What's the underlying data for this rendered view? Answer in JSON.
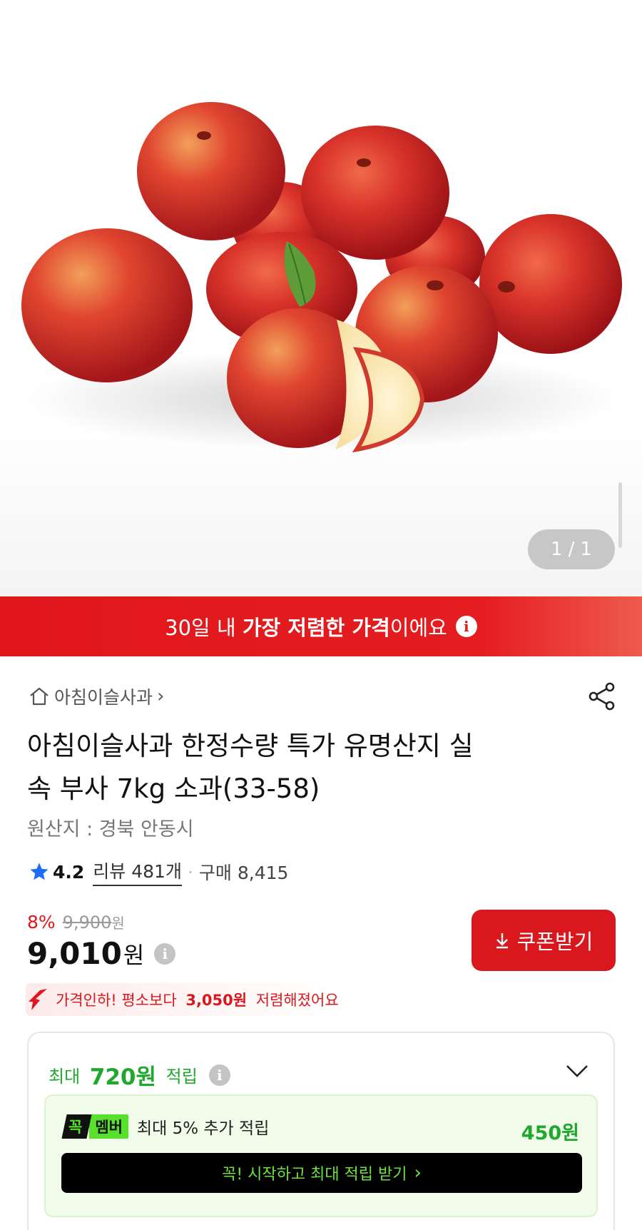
{
  "hero": {
    "image_alt": "apples product photo",
    "page_counter": {
      "current": "1",
      "separator": "/",
      "total": "1"
    }
  },
  "banner": {
    "prefix": "30일 내 ",
    "highlight": "가장 저렴한 가격",
    "suffix": "이에요",
    "info_icon": "i"
  },
  "store": {
    "home_icon": "home-icon",
    "name": "아침이슬사과",
    "chevron": "›"
  },
  "product": {
    "title_line1": "아침이슬사과 한정수량 특가 유명산지 실",
    "title_line2": "속 부사 7kg 소과(33-58)",
    "origin": "원산지 : 경북 안동시"
  },
  "rating": {
    "score": "4.2",
    "review": "리뷰 481개",
    "purchase": "구매 8,415",
    "separator": "·"
  },
  "price": {
    "discount_rate": "8%",
    "original": "9,900",
    "original_unit": "원",
    "final": "9,010",
    "final_unit": "원",
    "info_icon": "i"
  },
  "coupon": {
    "label": "쿠폰받기",
    "icon": "download-icon"
  },
  "price_drop": {
    "prefix": "가격인하! 평소보다 ",
    "amount": "3,050원",
    "suffix": " 저렴해졌어요"
  },
  "points": {
    "prefix": "최대 ",
    "amount": "720원",
    "suffix": " 적립",
    "info_icon": "i",
    "member": {
      "badge_left": "꼭",
      "badge_right": "멤버",
      "text": "최대 5% 추가 적립",
      "amount": "450원",
      "button": "꼭! 시작하고 최대 적립 받기",
      "button_chevron": "›"
    }
  },
  "colors": {
    "brand_red": "#e0161b",
    "points_green": "#20a82e",
    "member_green": "#57e02c"
  }
}
